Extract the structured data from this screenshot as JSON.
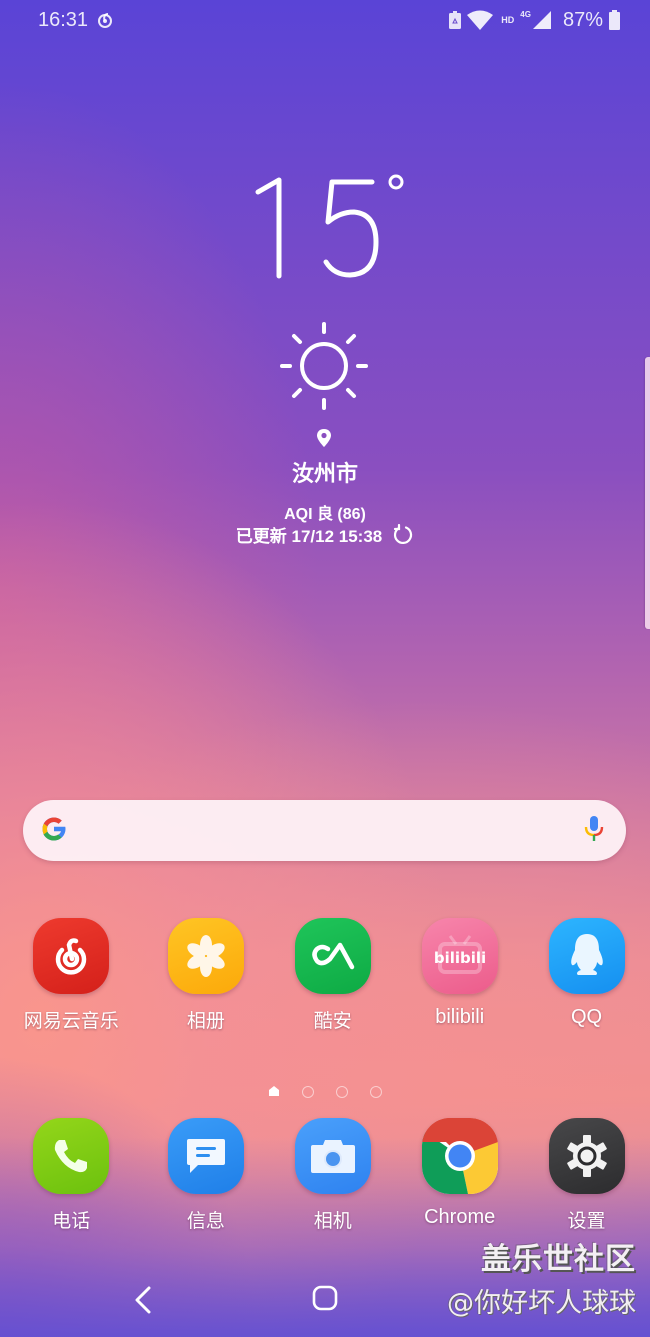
{
  "status_bar": {
    "time": "16:31",
    "notification_icons": [
      "netease-music-icon"
    ],
    "system_icons": [
      "battery-saver-icon",
      "wifi-icon",
      "hd-icon",
      "4g-signal-icon"
    ],
    "hd_label": "HD",
    "network_label": "4G",
    "battery_percent": "87%"
  },
  "weather": {
    "temperature": "15",
    "unit": "°",
    "condition_icon": "sun-icon",
    "location_icon": "pin-icon",
    "city": "汝州市",
    "aqi": "AQI 良 (86)",
    "updated_label": "已更新 17/12 15:38"
  },
  "search_bar": {
    "logo": "google-g-icon",
    "placeholder": "",
    "voice_icon": "microphone-icon"
  },
  "home_apps": [
    {
      "label": "网易云音乐",
      "icon": "netease-cloud-music-icon",
      "color": "#e2231a"
    },
    {
      "label": "相册",
      "icon": "gallery-icon",
      "color": "#fdb515"
    },
    {
      "label": "酷安",
      "icon": "coolapk-icon",
      "color": "#11b84a"
    },
    {
      "label": "bilibili",
      "icon": "bilibili-icon",
      "color": "#f26a95"
    },
    {
      "label": "QQ",
      "icon": "qq-penguin-icon",
      "color": "#1fa3f0"
    }
  ],
  "page_indicator": {
    "pages": 4,
    "current": 1,
    "first_is_home": true
  },
  "dock_apps": [
    {
      "label": "电话",
      "icon": "phone-icon",
      "color": "#7ccf10"
    },
    {
      "label": "信息",
      "icon": "messages-icon",
      "color": "#2d8ff0"
    },
    {
      "label": "相机",
      "icon": "camera-icon",
      "color": "#3f8ff5"
    },
    {
      "label": "Chrome",
      "icon": "chrome-icon",
      "color": "#db4437"
    },
    {
      "label": "设置",
      "icon": "settings-gear-icon",
      "color": "#3a3a3c"
    }
  ],
  "nav_bar": {
    "back": "back-icon",
    "home": "home-icon"
  },
  "watermark": {
    "title": "盖乐世社区",
    "user": "@你好坏人球球"
  }
}
